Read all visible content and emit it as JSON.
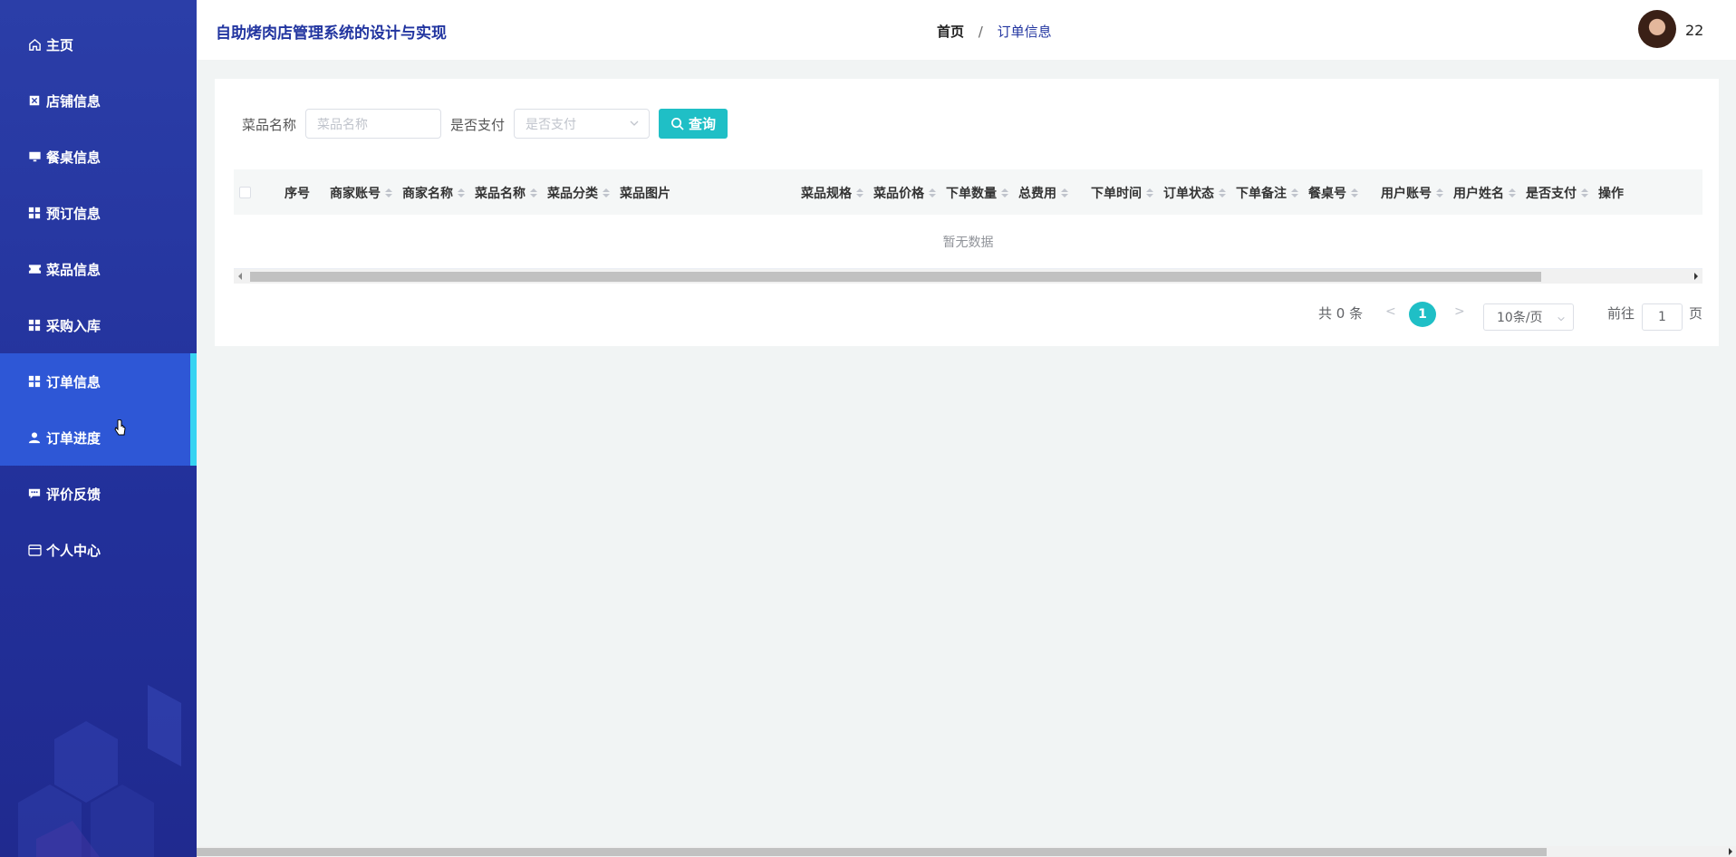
{
  "sidebar": {
    "items": [
      {
        "label": "主页",
        "icon": "home-icon"
      },
      {
        "label": "店铺信息",
        "icon": "store-icon"
      },
      {
        "label": "餐桌信息",
        "icon": "monitor-icon"
      },
      {
        "label": "预订信息",
        "icon": "grid-icon"
      },
      {
        "label": "菜品信息",
        "icon": "ticket-icon"
      },
      {
        "label": "采购入库",
        "icon": "grid-icon"
      },
      {
        "label": "订单信息",
        "icon": "grid-icon"
      },
      {
        "label": "订单进度",
        "icon": "user-icon"
      },
      {
        "label": "评价反馈",
        "icon": "comment-icon"
      },
      {
        "label": "个人中心",
        "icon": "wallet-icon"
      }
    ],
    "active_items": [
      "订单信息",
      "订单进度"
    ],
    "accent_color": "#37d3f2"
  },
  "header": {
    "title": "自助烤肉店管理系统的设计与实现",
    "breadcrumb_home": "首页",
    "breadcrumb_sep": "/",
    "breadcrumb_current": "订单信息",
    "username": "22"
  },
  "search": {
    "dish_label": "菜品名称",
    "dish_placeholder": "菜品名称",
    "paid_label": "是否支付",
    "paid_placeholder": "是否支付",
    "query_label": "查询"
  },
  "table": {
    "columns": [
      "序号",
      "商家账号",
      "商家名称",
      "菜品名称",
      "菜品分类",
      "菜品图片",
      "菜品规格",
      "菜品价格",
      "下单数量",
      "总费用",
      "下单时间",
      "订单状态",
      "下单备注",
      "餐桌号",
      "用户账号",
      "用户姓名",
      "是否支付",
      "操作"
    ],
    "empty_text": "暂无数据"
  },
  "pagination": {
    "total": "共 0 条",
    "prev": "<",
    "current_page": "1",
    "next": ">",
    "page_size": "10条/页",
    "goto_label": "前往",
    "goto_value": "1",
    "page_suffix": "页"
  },
  "colors": {
    "primary": "#1fbfc6",
    "sidebar_bg": "#2b3ea8",
    "title": "#2235a0"
  }
}
